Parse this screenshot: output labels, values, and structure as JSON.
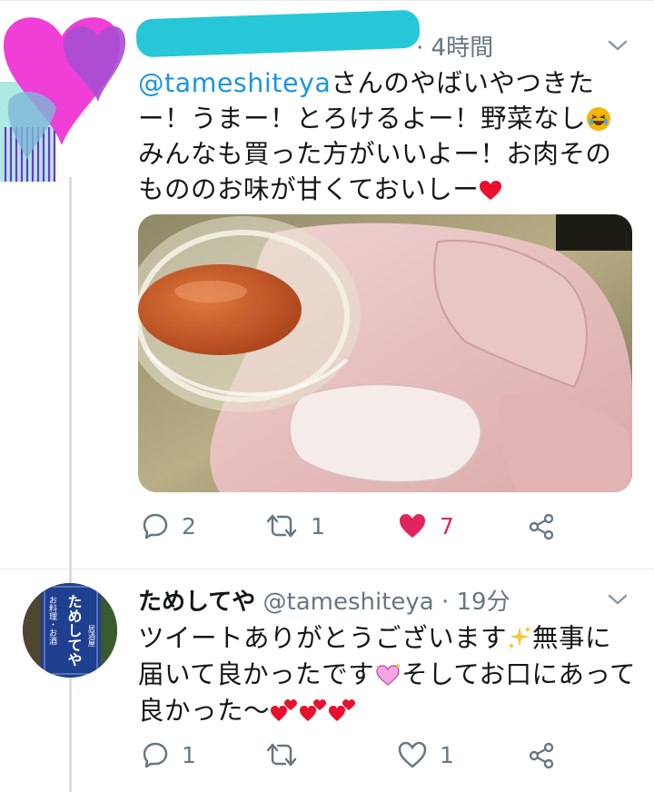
{
  "tweet1": {
    "time": "· 4時間",
    "mention": "@tameshiteya",
    "text_part1": "さんのやばいやつきたー！うまー！とろけるよー！野菜なし",
    "text_part2": "みんなも買った方がいいよー！お肉そのもののお味が甘くておいしー",
    "actions": {
      "replies": "2",
      "retweets": "1",
      "likes": "7"
    },
    "colors": {
      "like": "#e0245e",
      "meta": "#657786",
      "mention": "#1b95e0"
    },
    "icons": [
      "reply-icon",
      "retweet-icon",
      "heart-filled-icon",
      "share-icon",
      "chevron-down-icon",
      "laughing-emoji-icon",
      "red-heart-icon"
    ]
  },
  "tweet2": {
    "name": "ためしてや",
    "handle": "@tameshiteya",
    "time": "· 19分",
    "text_part1": "ツイートありがとうございます",
    "text_part2": "無事に届いて良かったです",
    "text_part3": "そしてお口にあって良かった〜",
    "avatar_sign_text": "ためしてや",
    "avatar_sign_top": "お料理・お酒",
    "avatar_sign_bottom": "居酒屋",
    "actions": {
      "replies": "1",
      "likes": "1"
    },
    "icons": [
      "sparkles-icon",
      "sparkling-heart-icon",
      "two-hearts-icon",
      "reply-icon",
      "retweet-icon",
      "heart-outline-icon",
      "share-icon"
    ]
  }
}
